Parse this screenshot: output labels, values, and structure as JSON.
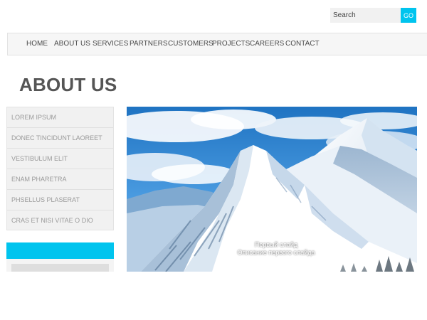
{
  "colors": {
    "accent": "#00c4ee",
    "text": "#555555",
    "menu_text": "#9a9a9a"
  },
  "search": {
    "placeholder": "Search",
    "button_label": "GO"
  },
  "nav": {
    "items": [
      {
        "label": "HOME"
      },
      {
        "label": "ABOUT US"
      },
      {
        "label": "SERVICES"
      },
      {
        "label": "PARTNERS"
      },
      {
        "label": "CUSTOMERS"
      },
      {
        "label": "PROJECTS"
      },
      {
        "label": "CAREERS"
      },
      {
        "label": "CONTACT"
      }
    ]
  },
  "page": {
    "title": "ABOUT US"
  },
  "side_menu": {
    "items": [
      {
        "label": "LOREM IPSUM"
      },
      {
        "label": "DONEC TINCIDUNT LAOREET"
      },
      {
        "label": "VESTIBULUM ELIT"
      },
      {
        "label": "ENAM PHARETRA"
      },
      {
        "label": "PHSELLUS PLASERAT"
      },
      {
        "label": "CRAS ET NISI VITAE O DIO"
      }
    ]
  },
  "slider": {
    "caption_title": "Первый слайд",
    "caption_text": "Описание первого слайда",
    "image_icon": "snowy-mountain-photo",
    "slide_count": 3,
    "active_slide": 1
  }
}
